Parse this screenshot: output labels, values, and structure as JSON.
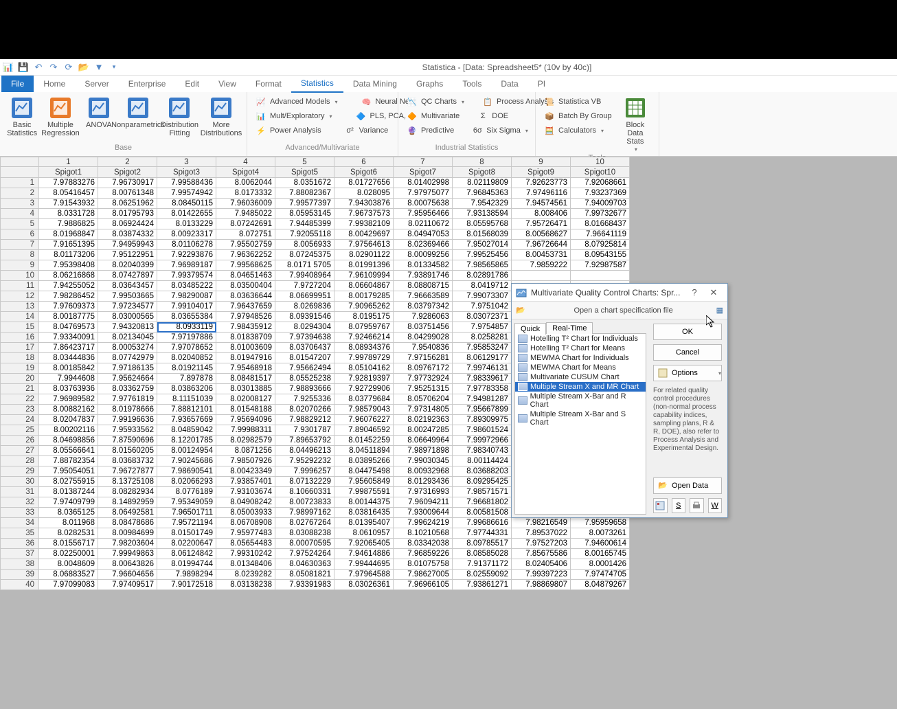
{
  "title": "Statistica - [Data: Spreadsheet5* (10v by 40c)]",
  "ribbonTabs": [
    "File",
    "Home",
    "Server",
    "Enterprise",
    "Edit",
    "View",
    "Format",
    "Statistics",
    "Data Mining",
    "Graphs",
    "Tools",
    "Data",
    "PI"
  ],
  "activeTab": "Statistics",
  "groups": {
    "base": {
      "label": "Base",
      "buttons": [
        "Basic\nStatistics",
        "Multiple\nRegression",
        "ANOVA",
        "Nonparametrics",
        "Distribution\nFitting",
        "More\nDistributions"
      ]
    },
    "advmulti": {
      "label": "Advanced/Multivariate",
      "items": [
        "Advanced Models",
        "Neural Nets",
        "Mult/Exploratory",
        "PLS, PCA, ...",
        "Power Analysis",
        "Variance"
      ]
    },
    "industrial": {
      "label": "Industrial Statistics",
      "items": [
        "QC Charts",
        "Process Analysis",
        "Multivariate",
        "DOE",
        "Predictive",
        "Six Sigma"
      ]
    },
    "tools": {
      "label": "Tools",
      "items": [
        "Statistica VB",
        "Batch By Group",
        "Calculators",
        "Block Data\nStats"
      ]
    }
  },
  "columns": [
    "Spigot1",
    "Spigot2",
    "Spigot3",
    "Spigot4",
    "Spigot5",
    "Spigot6",
    "Spigot7",
    "Spigot8",
    "Spigot9",
    "Spigot10"
  ],
  "data": [
    [
      "7.97883276",
      "7.96730917",
      "7.99588436",
      "8.0062044",
      "8.0351672",
      "8.01727656",
      "8.01402998",
      "8.02119809",
      "7.92623773",
      "7.92068661"
    ],
    [
      "8.05416457",
      "8.00761348",
      "7.99574942",
      "8.0173332",
      "7.88082367",
      "8.028095",
      "7.97975077",
      "7.96845363",
      "7.97496116",
      "7.93237369"
    ],
    [
      "7.91543932",
      "8.06251962",
      "8.08450115",
      "7.96036009",
      "7.99577397",
      "7.94303876",
      "8.00075638",
      "7.9542329",
      "7.94574561",
      "7.94009703"
    ],
    [
      "8.0331728",
      "8.01795793",
      "8.01422655",
      "7.9485022",
      "8.05953145",
      "7.96737573",
      "7.95956466",
      "7.93138594",
      "8.008406",
      "7.99732677"
    ],
    [
      "7.9886825",
      "8.06924424",
      "8.0133229",
      "8.07242691",
      "7.94485399",
      "7.99382109",
      "8.02110672",
      "8.05595768",
      "7.95726471",
      "8.01668437"
    ],
    [
      "8.01968847",
      "8.03874332",
      "8.00923317",
      "8.072751",
      "7.92055118",
      "8.00429697",
      "8.04947053",
      "8.01568039",
      "8.00568627",
      "7.96641119"
    ],
    [
      "7.91651395",
      "7.94959943",
      "8.01106278",
      "7.95502759",
      "8.0056933",
      "7.97564613",
      "8.02369466",
      "7.95027014",
      "7.96726644",
      "8.07925814"
    ],
    [
      "8.01173206",
      "7.95122951",
      "7.92293876",
      "7.96362252",
      "8.07245375",
      "8.02901122",
      "8.00099256",
      "7.99525456",
      "8.00453731",
      "8.09543155"
    ],
    [
      "7.95398408",
      "8.02040399",
      "7.96989187",
      "7.99568625",
      "8.0171 5705",
      "8.01991396",
      "8.01334582",
      "7.98565865",
      "7.9859222",
      "7.92987587"
    ],
    [
      "8.06216868",
      "8.07427897",
      "7.99379574",
      "8.04651463",
      "7.99408964",
      "7.96109994",
      "7.93891746",
      "8.02891786",
      "",
      ""
    ],
    [
      "7.94255052",
      "8.03643457",
      "8.03485222",
      "8.03500404",
      "7.9727204",
      "8.06604867",
      "8.08808715",
      "8.0419712",
      "",
      ""
    ],
    [
      "7.98286452",
      "7.99503665",
      "7.98290087",
      "8.03636644",
      "8.06699951",
      "8.00179285",
      "7.96663589",
      "7.99073307",
      "",
      ""
    ],
    [
      "7.97609373",
      "7.97234577",
      "7.99104017",
      "7.96437659",
      "8.0269836",
      "7.90965262",
      "8.03797342",
      "7.9751042",
      "",
      ""
    ],
    [
      "8.00187775",
      "8.03000565",
      "8.03655384",
      "7.97948526",
      "8.09391546",
      "8.0195175",
      "7.9286063",
      "8.03072371",
      "",
      ""
    ],
    [
      "8.04769573",
      "7.94320813",
      "8.0933119",
      "7.98435912",
      "8.0294304",
      "8.07959767",
      "8.03751456",
      "7.9754857",
      "",
      ""
    ],
    [
      "7.93340091",
      "8.02134045",
      "7.97197886",
      "8.01838709",
      "7.97394638",
      "7.92466214",
      "8.04299028",
      "8.0258281",
      "",
      ""
    ],
    [
      "7.86423717",
      "8.00053274",
      "7.97078652",
      "8.01003609",
      "8.03706437",
      "8.08934376",
      "7.9540836",
      "7.95853247",
      "",
      ""
    ],
    [
      "8.03444836",
      "8.07742979",
      "8.02040852",
      "8.01947916",
      "8.01547207",
      "7.99789729",
      "7.97156281",
      "8.06129177",
      "",
      ""
    ],
    [
      "8.00185842",
      "7.97186135",
      "8.01921145",
      "7.95468918",
      "7.95662494",
      "8.05104162",
      "8.09767172",
      "7.99746131",
      "",
      ""
    ],
    [
      "7.9944608",
      "7.95624664",
      "7.897878",
      "8.08481517",
      "8.05525238",
      "7.92819397",
      "7.97732924",
      "7.98339617",
      "",
      ""
    ],
    [
      "8.03763936",
      "8.03362759",
      "8.03863206",
      "8.03013885",
      "7.98893666",
      "7.92729906",
      "7.95251315",
      "7.97783358",
      "",
      ""
    ],
    [
      "7.96989582",
      "7.97761819",
      "8.11151039",
      "8.02008127",
      "7.9255336",
      "8.03779684",
      "8.05706204",
      "7.94981287",
      "",
      ""
    ],
    [
      "8.00882162",
      "8.01978666",
      "7.88812101",
      "8.01548188",
      "8.02070266",
      "7.98579043",
      "7.97314805",
      "7.95667899",
      "",
      ""
    ],
    [
      "8.02047837",
      "7.99196636",
      "7.93657669",
      "7.95694096",
      "7.98829212",
      "7.96076227",
      "8.02192363",
      "7.89309975",
      "",
      ""
    ],
    [
      "8.00202116",
      "7.95933562",
      "8.04859042",
      "7.99988311",
      "7.9301787",
      "7.89046592",
      "8.00247285",
      "7.98601524",
      "",
      ""
    ],
    [
      "8.04698856",
      "7.87590696",
      "8.12201785",
      "8.02982579",
      "7.89653792",
      "8.01452259",
      "8.06649964",
      "7.99972966",
      "",
      ""
    ],
    [
      "8.05566641",
      "8.01560205",
      "8.00124954",
      "8.0871256",
      "8.04496213",
      "8.04511894",
      "7.98971898",
      "7.98340743",
      "",
      ""
    ],
    [
      "7.88782354",
      "8.03683732",
      "7.90245686",
      "7.98507926",
      "7.95292232",
      "8.03895266",
      "7.99030345",
      "8.00114424",
      "",
      ""
    ],
    [
      "7.95054051",
      "7.96727877",
      "7.98690541",
      "8.00423349",
      "7.9996257",
      "8.04475498",
      "8.00932968",
      "8.03688203",
      "",
      ""
    ],
    [
      "8.02755915",
      "8.13725108",
      "8.02066293",
      "7.93857401",
      "8.07132229",
      "7.95605849",
      "8.01293436",
      "8.09295425",
      "",
      ""
    ],
    [
      "8.01387244",
      "8.08282934",
      "8.0776189",
      "7.93103674",
      "8.10660331",
      "7.99875591",
      "7.97316993",
      "7.98571571",
      "",
      ""
    ],
    [
      "7.97409799",
      "8.14892959",
      "7.95349059",
      "8.04908242",
      "8.00723833",
      "8.00144375",
      "7.96094211",
      "7.96681802",
      "",
      ""
    ],
    [
      "8.0365125",
      "8.06492581",
      "7.96501711",
      "8.05003933",
      "7.98997162",
      "8.03816435",
      "7.93009644",
      "8.00581508",
      "",
      ""
    ],
    [
      "8.011968",
      "8.08478686",
      "7.95721194",
      "8.06708908",
      "8.02767264",
      "8.01395407",
      "7.99624219",
      "7.99686616",
      "7.98216549",
      "7.95959658"
    ],
    [
      "8.0282531",
      "8.00984699",
      "8.01501749",
      "7.95977483",
      "8.03088238",
      "8.0610957",
      "8.10210568",
      "7.97744331",
      "7.89537022",
      "8.0073261"
    ],
    [
      "8.01556717",
      "7.98203604",
      "8.02200647",
      "8.05654483",
      "8.00070595",
      "7.92065405",
      "8.03342038",
      "8.09785517",
      "7.97527203",
      "7.94600614"
    ],
    [
      "8.02250001",
      "7.99949863",
      "8.06124842",
      "7.99310242",
      "7.97524264",
      "7.94614886",
      "7.96859226",
      "8.08585028",
      "7.85675586",
      "8.00165745"
    ],
    [
      "8.0048609",
      "8.00643826",
      "8.01994744",
      "8.01348406",
      "8.04630363",
      "7.99444695",
      "8.01075758",
      "7.91371172",
      "8.02405406",
      "8.0001426"
    ],
    [
      "8.06883527",
      "7.96604656",
      "7.9898294",
      "8.0239282",
      "8.05081821",
      "7.97964588",
      "7.98627005",
      "8.02559092",
      "7.99397223",
      "7.97474705"
    ],
    [
      "7.97099083",
      "7.97409517",
      "7.90172518",
      "8.03138238",
      "7.93391983",
      "8.03026361",
      "7.96966105",
      "7.93861271",
      "7.98869807",
      "8.04879267"
    ]
  ],
  "selectedCell": {
    "row": 15,
    "col": 3
  },
  "dialog": {
    "title": "Multivariate Quality Control Charts: Spr...",
    "openSpec": "Open a chart specification file",
    "tabs": [
      "Quick",
      "Real-Time"
    ],
    "activeTab": "Quick",
    "items": [
      "Hotelling T² Chart for Individuals",
      "Hotelling T² Chart for Means",
      "MEWMA Chart for Individuals",
      "MEWMA Chart for Means",
      "Multivariate CUSUM Chart",
      "Multiple Stream X and MR Chart",
      "Multiple Stream X-Bar and R Chart",
      "Multiple Stream X-Bar and S Chart"
    ],
    "selected": 5,
    "buttons": {
      "ok": "OK",
      "cancel": "Cancel",
      "options": "Options",
      "openData": "Open Data"
    },
    "help": "For related quality control procedures (non-normal process capability indices, sampling plans, R & R, DOE), also refer to Process Analysis and Experimental Design.",
    "mini": [
      "S",
      "W"
    ]
  }
}
